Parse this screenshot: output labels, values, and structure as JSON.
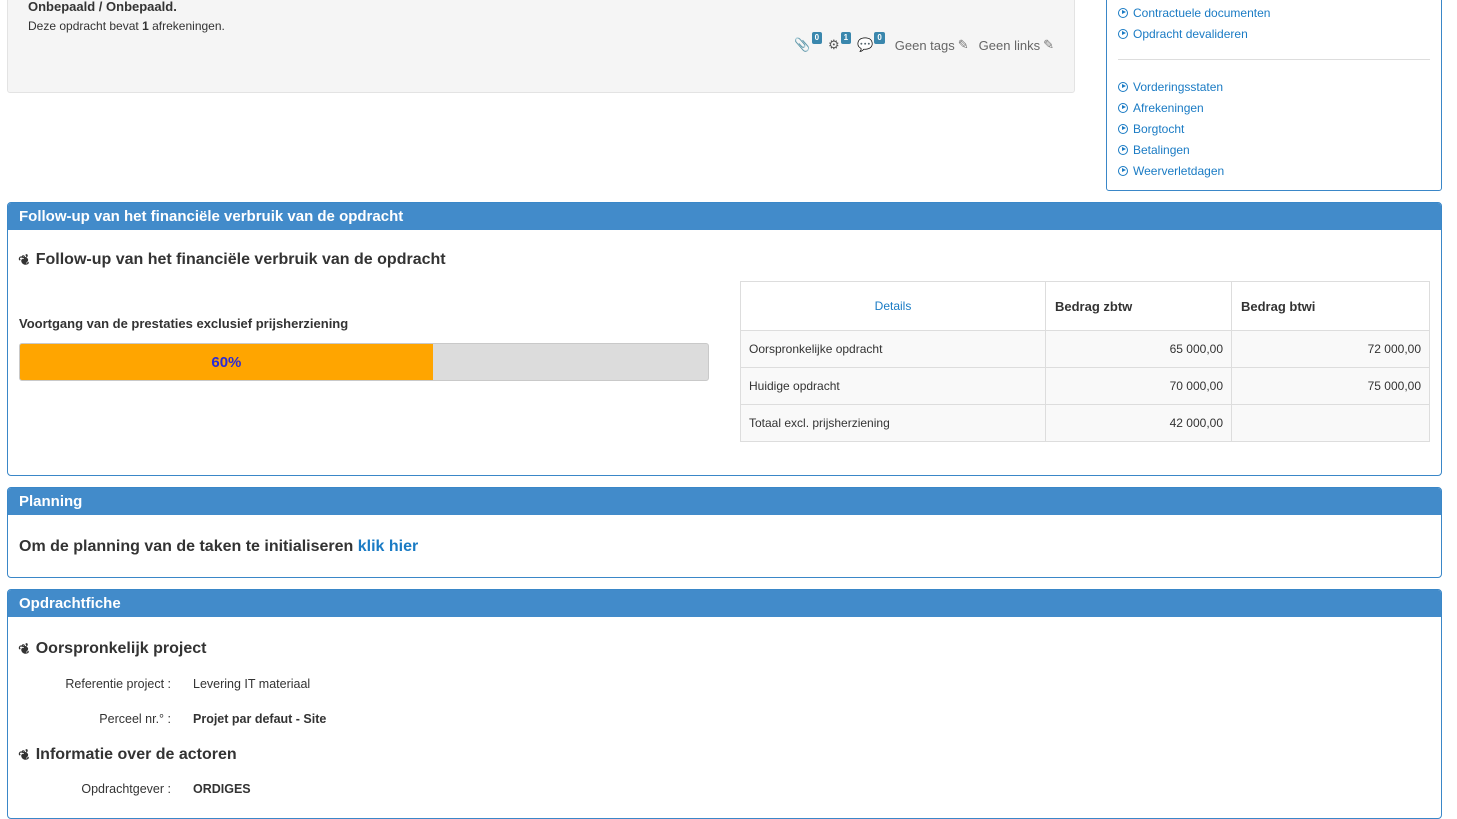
{
  "info": {
    "status_text": "Onbepaald / Onbepaald.",
    "count_prefix": "Deze opdracht bevat",
    "count_value": "1",
    "count_suffix": "afrekeningen.",
    "attachments_count": "0",
    "settings_count": "1",
    "comments_count": "0",
    "tags_text": "Geen tags",
    "links_text": "Geen links"
  },
  "actions": {
    "group1": [
      "Contractuele documenten",
      "Opdracht devalideren"
    ],
    "group2": [
      "Vorderingsstaten",
      "Afrekeningen",
      "Borgtocht",
      "Betalingen",
      "Weerverletdagen"
    ]
  },
  "followup": {
    "panel_title": "Follow-up van het financiële verbruik van de opdracht",
    "section_title": "Follow-up van het financiële verbruik van de opdracht",
    "progress_label": "Voortgang van de prestaties exclusief prijsherziening",
    "progress_value": 0.6,
    "progress_text": "60%",
    "table": {
      "headers": [
        "Details",
        "Bedrag zbtw",
        "Bedrag btwi"
      ],
      "rows": [
        [
          "Oorspronkelijke opdracht",
          "65 000,00",
          "72 000,00"
        ],
        [
          "Huidige opdracht",
          "70 000,00",
          "75 000,00"
        ],
        [
          "Totaal excl. prijsherziening",
          "42 000,00",
          ""
        ]
      ]
    }
  },
  "planning": {
    "panel_title": "Planning",
    "text": "Om de planning van de taken te initialiseren",
    "link": "klik hier"
  },
  "fiche": {
    "panel_title": "Opdrachtfiche",
    "section1_title": "Oorspronkelijk project",
    "ref_label": "Referentie project :",
    "ref_value": "Levering IT materiaal",
    "perceel_label": "Perceel nr.° :",
    "perceel_value": "Projet par defaut - Site",
    "section2_title": "Informatie over de actoren",
    "opdrachtgever_label": "Opdrachtgever :",
    "opdrachtgever_value": "ORDIGES"
  }
}
